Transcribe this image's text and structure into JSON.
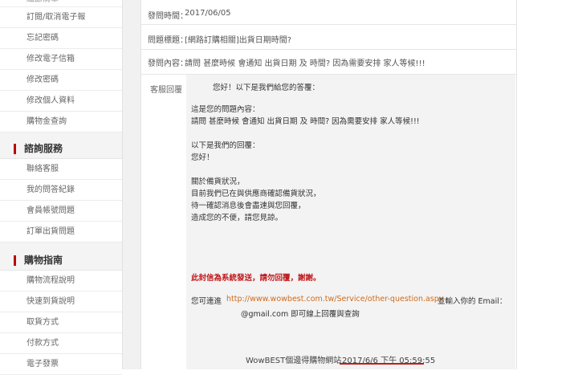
{
  "sidebar": {
    "top_items": [
      "細節清單",
      "訂閱/取消電子報",
      "忘記密碼",
      "修改電子信箱",
      "修改密碼",
      "修改個人資料",
      "購物金查詢"
    ],
    "section1": {
      "title": "諮詢服務",
      "items": [
        "聯絡客服",
        "我的問答紀錄",
        "會員帳號問題",
        "訂單出貨問題"
      ]
    },
    "section2": {
      "title": "購物指南",
      "items": [
        "購物流程說明",
        "快速到貨說明",
        "取貨方式",
        "付款方式",
        "電子發票"
      ]
    }
  },
  "question": {
    "time_label": "發問時間：",
    "time_value": "2017/06/05",
    "subject_label": "問題標題：",
    "subject_value": "[網路訂購相關]出貨日期時間?",
    "content_label": "發問內容：",
    "content_value": "請問 甚麼時候 會通知 出貨日期 及 時間? 因為需要安排 家人等候!!!"
  },
  "reply": {
    "label": "客服回覆",
    "greeting": "您好！以下是我們給您的答覆：",
    "q_intro": "這是您的問題內容：",
    "q_text": "請問 甚麼時候 會通知 出貨日期 及 時間? 因為需要安排 家人等候!!!",
    "a_intro": "以下是我們的回覆：",
    "a_hello": "您好！",
    "lines": [
      "關於備貨狀況，",
      "目前我們已在與供應商確認備貨狀況，",
      "待一確認消息後會盡速與您回覆，",
      "造成您的不便，請您見諒。"
    ],
    "notice": "此封信為系統發送，請勿回覆，謝謝。",
    "follow_prefix": "您可連進",
    "follow_url": "http://www.wowbest.com.tw/Service/other-question.aspx",
    "follow_suffix": "並輸入你的 Email：",
    "email": "@gmail.com 即可線上回覆與查詢",
    "signature": "WowBEST個邊得購物網站",
    "sent_time": "2017/6/6 下午 05:59:55"
  }
}
